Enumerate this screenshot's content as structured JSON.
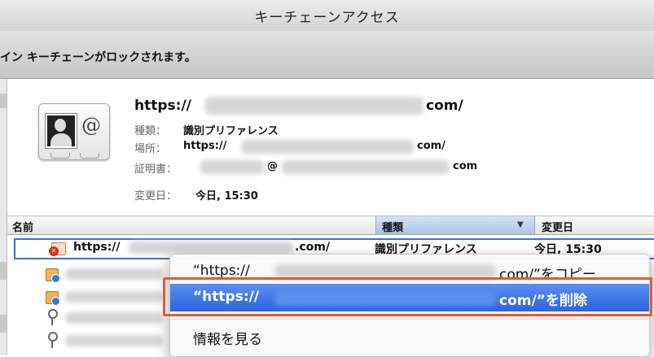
{
  "window": {
    "title": "キーチェーンアクセス"
  },
  "lockbar": {
    "text": "イン キーチェーンがロックされます。"
  },
  "detail": {
    "title_prefix": "https://",
    "title_suffix": "com/",
    "kind_label": "種類：",
    "kind_value": "識別プリファレンス",
    "location_label": "場所：",
    "location_prefix": "https://",
    "location_suffix": "com/",
    "certificate_label": "証明書：",
    "certificate_at": "@",
    "certificate_suffix": "com",
    "modified_label": "変更日：",
    "modified_value": "今日, 15:30"
  },
  "table": {
    "columns": [
      "名前",
      "種類",
      "変更日"
    ],
    "sort_arrow": "▼",
    "selected_row": {
      "name_prefix": "https://",
      "name_suffix": ".com/",
      "kind": "識別プリファレンス",
      "modified": "今日, 15:30"
    },
    "other_rows": [
      {
        "icon": "certificate-icon"
      },
      {
        "icon": "certificate-icon"
      },
      {
        "icon": "key-icon"
      },
      {
        "icon": "key-icon"
      }
    ]
  },
  "context_menu": {
    "items": [
      {
        "prefix": "“https://",
        "suffix": "com/”をコピー"
      },
      {
        "prefix": "“https://",
        "suffix": "com/”を削除",
        "highlighted": true
      },
      {
        "label": "情報を見る"
      }
    ]
  },
  "colors": {
    "menu_highlight": "#3a6fe4",
    "annotation_box": "#e45a38",
    "selection_border": "#3b6ed6"
  }
}
